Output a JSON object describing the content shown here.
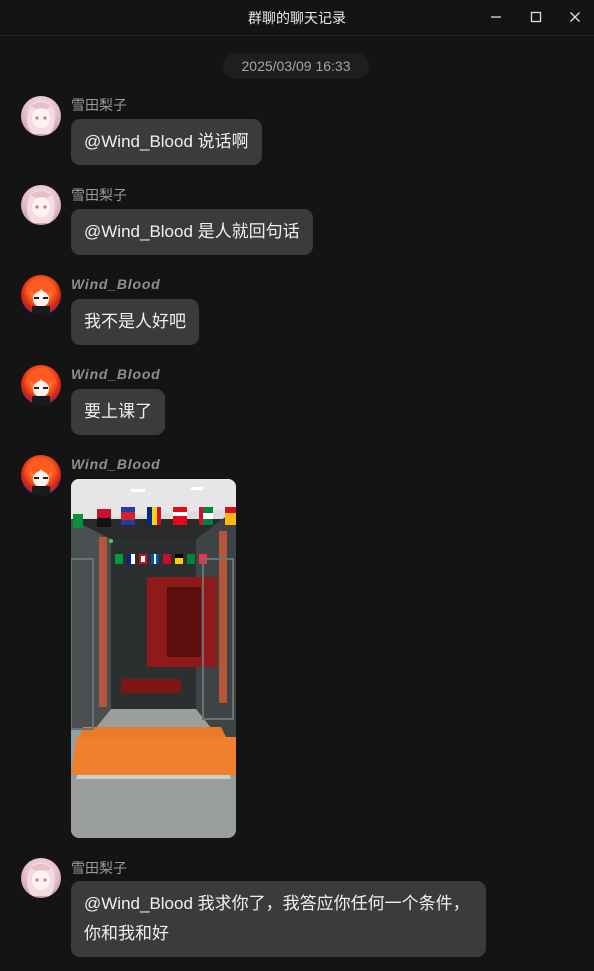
{
  "window": {
    "title": "群聊的聊天记录",
    "controls": {
      "minimize": "minimize-icon",
      "maximize": "maximize-icon",
      "close": "close-icon"
    }
  },
  "chat": {
    "timestamp": "2025/03/09 16:33",
    "messages": [
      {
        "sender": "雪田梨子",
        "text": "@Wind_Blood 说话啊",
        "avatar": "pink-haired-girl-avatar"
      },
      {
        "sender": "雪田梨子",
        "text": "@Wind_Blood 是人就回句话",
        "avatar": "pink-haired-girl-avatar"
      },
      {
        "sender": "Wind_Blood",
        "text": "我不是人好吧",
        "avatar": "red-haired-character-avatar"
      },
      {
        "sender": "Wind_Blood",
        "text": "要上课了",
        "avatar": "red-haired-character-avatar"
      },
      {
        "sender": "Wind_Blood",
        "image": "hallway-with-international-flags-photo",
        "avatar": "red-haired-character-avatar"
      },
      {
        "sender": "雪田梨子",
        "text": "@Wind_Blood 我求你了，我答应你任何一个条件，你和我和好",
        "avatar": "pink-haired-girl-avatar"
      }
    ]
  },
  "colors": {
    "background": "#141414",
    "bubble": "#3b3b3b",
    "text": "#f0f0f0",
    "sender": "#9a9a9a"
  }
}
